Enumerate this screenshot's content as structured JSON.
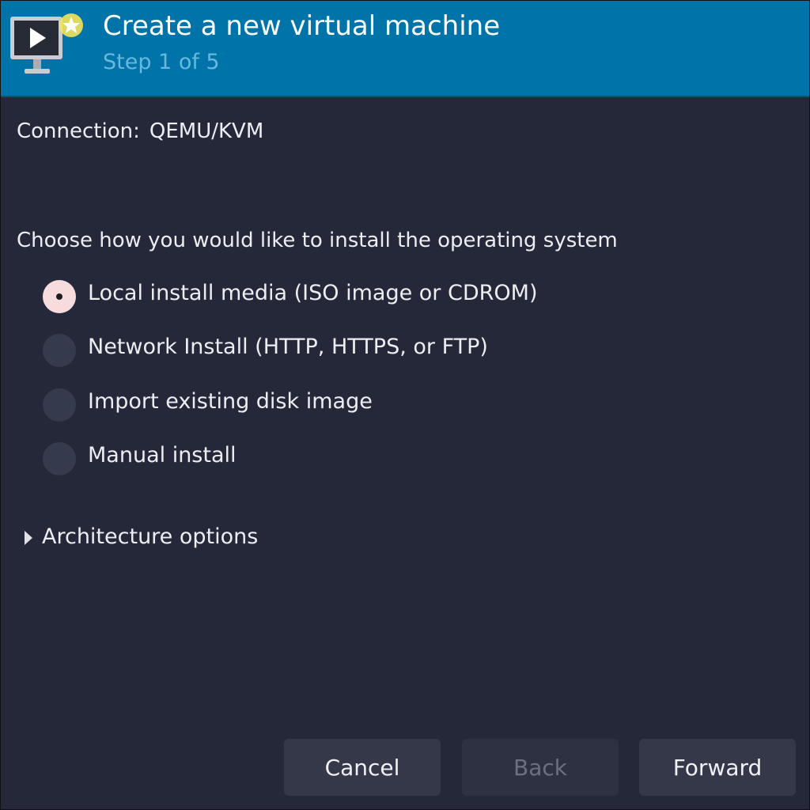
{
  "header": {
    "title": "Create a new virtual machine",
    "subtitle": "Step 1 of 5",
    "icon": "virtual-machine-new-icon"
  },
  "connection": {
    "label": "Connection:",
    "value": "QEMU/KVM"
  },
  "install": {
    "prompt": "Choose how you would like to install the operating system",
    "options": [
      {
        "label": "Local install media (ISO image or CDROM)",
        "checked": true
      },
      {
        "label": "Network Install (HTTP, HTTPS, or FTP)",
        "checked": false
      },
      {
        "label": "Import existing disk image",
        "checked": false
      },
      {
        "label": "Manual install",
        "checked": false
      }
    ]
  },
  "architecture": {
    "label": "Architecture options",
    "expanded": false
  },
  "buttons": {
    "cancel": "Cancel",
    "back": "Back",
    "forward": "Forward"
  },
  "colors": {
    "header_bg": "#0073a8",
    "body_bg": "#252838",
    "subtitle": "#68b8de",
    "radio_checked": "#f6dcdc"
  }
}
